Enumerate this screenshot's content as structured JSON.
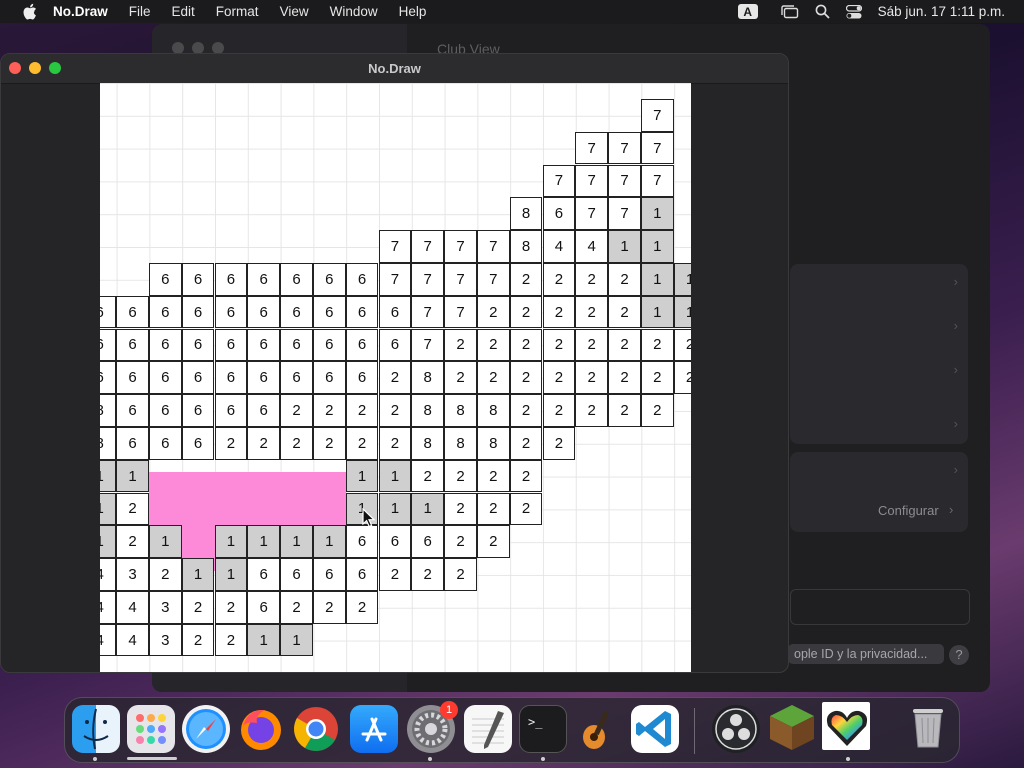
{
  "menubar": {
    "app_name": "No.Draw",
    "menus": [
      "File",
      "Edit",
      "Format",
      "View",
      "Window",
      "Help"
    ],
    "input_source": "A",
    "clock": "Sáb jun. 17  1:11 p.m."
  },
  "background_window": {
    "title": "Club View",
    "configurar_label": "Configurar",
    "privacy_button": "ople ID y la privacidad...",
    "help_label": "?"
  },
  "app_window": {
    "title": "No.Draw",
    "grid": {
      "rows": [
        {
          "r": 0,
          "cells": [
            {
              "c": 17,
              "v": "7"
            }
          ]
        },
        {
          "r": 1,
          "cells": [
            {
              "c": 15,
              "v": "7"
            },
            {
              "c": 16,
              "v": "7"
            },
            {
              "c": 17,
              "v": "7"
            }
          ]
        },
        {
          "r": 2,
          "cells": [
            {
              "c": 14,
              "v": "7"
            },
            {
              "c": 15,
              "v": "7"
            },
            {
              "c": 16,
              "v": "7"
            },
            {
              "c": 17,
              "v": "7"
            }
          ]
        },
        {
          "r": 3,
          "cells": [
            {
              "c": 13,
              "v": "8"
            },
            {
              "c": 14,
              "v": "6"
            },
            {
              "c": 15,
              "v": "7"
            },
            {
              "c": 16,
              "v": "7"
            },
            {
              "c": 17,
              "v": "1",
              "g": true
            }
          ]
        },
        {
          "r": 4,
          "cells": [
            {
              "c": 9,
              "v": "7"
            },
            {
              "c": 10,
              "v": "7"
            },
            {
              "c": 11,
              "v": "7"
            },
            {
              "c": 12,
              "v": "7"
            },
            {
              "c": 13,
              "v": "8"
            },
            {
              "c": 14,
              "v": "4"
            },
            {
              "c": 15,
              "v": "4"
            },
            {
              "c": 16,
              "v": "1",
              "g": true
            },
            {
              "c": 17,
              "v": "1",
              "g": true
            }
          ]
        },
        {
          "r": 5,
          "cells": [
            {
              "c": 2,
              "v": "6"
            },
            {
              "c": 3,
              "v": "6"
            },
            {
              "c": 4,
              "v": "6"
            },
            {
              "c": 5,
              "v": "6"
            },
            {
              "c": 6,
              "v": "6"
            },
            {
              "c": 7,
              "v": "6"
            },
            {
              "c": 8,
              "v": "6"
            },
            {
              "c": 9,
              "v": "7"
            },
            {
              "c": 10,
              "v": "7"
            },
            {
              "c": 11,
              "v": "7"
            },
            {
              "c": 12,
              "v": "7"
            },
            {
              "c": 13,
              "v": "2"
            },
            {
              "c": 14,
              "v": "2"
            },
            {
              "c": 15,
              "v": "2"
            },
            {
              "c": 16,
              "v": "2"
            },
            {
              "c": 17,
              "v": "1",
              "g": true
            },
            {
              "c": 18,
              "v": "1",
              "g": true
            }
          ]
        },
        {
          "r": 6,
          "cells": [
            {
              "c": 0,
              "v": "6"
            },
            {
              "c": 1,
              "v": "6"
            },
            {
              "c": 2,
              "v": "6"
            },
            {
              "c": 3,
              "v": "6"
            },
            {
              "c": 4,
              "v": "6"
            },
            {
              "c": 5,
              "v": "6"
            },
            {
              "c": 6,
              "v": "6"
            },
            {
              "c": 7,
              "v": "6"
            },
            {
              "c": 8,
              "v": "6"
            },
            {
              "c": 9,
              "v": "6"
            },
            {
              "c": 10,
              "v": "7"
            },
            {
              "c": 11,
              "v": "7"
            },
            {
              "c": 12,
              "v": "2"
            },
            {
              "c": 13,
              "v": "2"
            },
            {
              "c": 14,
              "v": "2"
            },
            {
              "c": 15,
              "v": "2"
            },
            {
              "c": 16,
              "v": "2"
            },
            {
              "c": 17,
              "v": "1",
              "g": true
            },
            {
              "c": 18,
              "v": "1",
              "g": true
            }
          ]
        },
        {
          "r": 7,
          "cells": [
            {
              "c": 0,
              "v": "6"
            },
            {
              "c": 1,
              "v": "6"
            },
            {
              "c": 2,
              "v": "6"
            },
            {
              "c": 3,
              "v": "6"
            },
            {
              "c": 4,
              "v": "6"
            },
            {
              "c": 5,
              "v": "6"
            },
            {
              "c": 6,
              "v": "6"
            },
            {
              "c": 7,
              "v": "6"
            },
            {
              "c": 8,
              "v": "6"
            },
            {
              "c": 9,
              "v": "6"
            },
            {
              "c": 10,
              "v": "7"
            },
            {
              "c": 11,
              "v": "2"
            },
            {
              "c": 12,
              "v": "2"
            },
            {
              "c": 13,
              "v": "2"
            },
            {
              "c": 14,
              "v": "2"
            },
            {
              "c": 15,
              "v": "2"
            },
            {
              "c": 16,
              "v": "2"
            },
            {
              "c": 17,
              "v": "2"
            },
            {
              "c": 18,
              "v": "2"
            }
          ]
        },
        {
          "r": 8,
          "cells": [
            {
              "c": 0,
              "v": "6"
            },
            {
              "c": 1,
              "v": "6"
            },
            {
              "c": 2,
              "v": "6"
            },
            {
              "c": 3,
              "v": "6"
            },
            {
              "c": 4,
              "v": "6"
            },
            {
              "c": 5,
              "v": "6"
            },
            {
              "c": 6,
              "v": "6"
            },
            {
              "c": 7,
              "v": "6"
            },
            {
              "c": 8,
              "v": "6"
            },
            {
              "c": 9,
              "v": "2"
            },
            {
              "c": 10,
              "v": "8"
            },
            {
              "c": 11,
              "v": "2"
            },
            {
              "c": 12,
              "v": "2"
            },
            {
              "c": 13,
              "v": "2"
            },
            {
              "c": 14,
              "v": "2"
            },
            {
              "c": 15,
              "v": "2"
            },
            {
              "c": 16,
              "v": "2"
            },
            {
              "c": 17,
              "v": "2"
            },
            {
              "c": 18,
              "v": "2"
            }
          ]
        },
        {
          "r": 9,
          "cells": [
            {
              "c": 0,
              "v": "8"
            },
            {
              "c": 1,
              "v": "6"
            },
            {
              "c": 2,
              "v": "6"
            },
            {
              "c": 3,
              "v": "6"
            },
            {
              "c": 4,
              "v": "6"
            },
            {
              "c": 5,
              "v": "6"
            },
            {
              "c": 6,
              "v": "2"
            },
            {
              "c": 7,
              "v": "2"
            },
            {
              "c": 8,
              "v": "2"
            },
            {
              "c": 9,
              "v": "2"
            },
            {
              "c": 10,
              "v": "8"
            },
            {
              "c": 11,
              "v": "8"
            },
            {
              "c": 12,
              "v": "8"
            },
            {
              "c": 13,
              "v": "2"
            },
            {
              "c": 14,
              "v": "2"
            },
            {
              "c": 15,
              "v": "2"
            },
            {
              "c": 16,
              "v": "2"
            },
            {
              "c": 17,
              "v": "2"
            }
          ]
        },
        {
          "r": 10,
          "cells": [
            {
              "c": 0,
              "v": "8"
            },
            {
              "c": 1,
              "v": "6"
            },
            {
              "c": 2,
              "v": "6"
            },
            {
              "c": 3,
              "v": "6"
            },
            {
              "c": 4,
              "v": "2"
            },
            {
              "c": 5,
              "v": "2"
            },
            {
              "c": 6,
              "v": "2"
            },
            {
              "c": 7,
              "v": "2"
            },
            {
              "c": 8,
              "v": "2"
            },
            {
              "c": 9,
              "v": "2"
            },
            {
              "c": 10,
              "v": "8"
            },
            {
              "c": 11,
              "v": "8"
            },
            {
              "c": 12,
              "v": "8"
            },
            {
              "c": 13,
              "v": "2"
            },
            {
              "c": 14,
              "v": "2"
            }
          ]
        },
        {
          "r": 11,
          "cells": [
            {
              "c": 0,
              "v": "1",
              "g": true
            },
            {
              "c": 1,
              "v": "1",
              "g": true
            },
            {
              "c": 8,
              "v": "1",
              "g": true
            },
            {
              "c": 9,
              "v": "1",
              "g": true
            },
            {
              "c": 10,
              "v": "2"
            },
            {
              "c": 11,
              "v": "2"
            },
            {
              "c": 12,
              "v": "2"
            },
            {
              "c": 13,
              "v": "2"
            }
          ]
        },
        {
          "r": 12,
          "cells": [
            {
              "c": 0,
              "v": "1",
              "g": true
            },
            {
              "c": 1,
              "v": "2"
            },
            {
              "c": 8,
              "v": "1",
              "g": true
            },
            {
              "c": 9,
              "v": "1",
              "g": true
            },
            {
              "c": 10,
              "v": "1",
              "g": true
            },
            {
              "c": 11,
              "v": "2"
            },
            {
              "c": 12,
              "v": "2"
            },
            {
              "c": 13,
              "v": "2"
            }
          ]
        },
        {
          "r": 13,
          "cells": [
            {
              "c": 0,
              "v": "1",
              "g": true
            },
            {
              "c": 1,
              "v": "2"
            },
            {
              "c": 2,
              "v": "1",
              "g": true
            },
            {
              "c": 4,
              "v": "1",
              "g": true
            },
            {
              "c": 5,
              "v": "1",
              "g": true
            },
            {
              "c": 6,
              "v": "1",
              "g": true
            },
            {
              "c": 7,
              "v": "1",
              "g": true
            },
            {
              "c": 8,
              "v": "6"
            },
            {
              "c": 9,
              "v": "6"
            },
            {
              "c": 10,
              "v": "6"
            },
            {
              "c": 11,
              "v": "2"
            },
            {
              "c": 12,
              "v": "2"
            }
          ]
        },
        {
          "r": 14,
          "cells": [
            {
              "c": 0,
              "v": "4"
            },
            {
              "c": 1,
              "v": "3"
            },
            {
              "c": 2,
              "v": "2"
            },
            {
              "c": 3,
              "v": "1",
              "g": true
            },
            {
              "c": 4,
              "v": "1",
              "g": true
            },
            {
              "c": 5,
              "v": "6"
            },
            {
              "c": 6,
              "v": "6"
            },
            {
              "c": 7,
              "v": "6"
            },
            {
              "c": 8,
              "v": "6"
            },
            {
              "c": 9,
              "v": "2"
            },
            {
              "c": 10,
              "v": "2"
            },
            {
              "c": 11,
              "v": "2"
            }
          ]
        },
        {
          "r": 15,
          "cells": [
            {
              "c": 0,
              "v": "4"
            },
            {
              "c": 1,
              "v": "4"
            },
            {
              "c": 2,
              "v": "3"
            },
            {
              "c": 3,
              "v": "2"
            },
            {
              "c": 4,
              "v": "2"
            },
            {
              "c": 5,
              "v": "6"
            },
            {
              "c": 6,
              "v": "2"
            },
            {
              "c": 7,
              "v": "2"
            },
            {
              "c": 8,
              "v": "2"
            }
          ]
        },
        {
          "r": 16,
          "cells": [
            {
              "c": 0,
              "v": "4"
            },
            {
              "c": 1,
              "v": "4"
            },
            {
              "c": 2,
              "v": "3"
            },
            {
              "c": 3,
              "v": "2"
            },
            {
              "c": 4,
              "v": "2"
            },
            {
              "c": 5,
              "v": "1",
              "g": true
            },
            {
              "c": 6,
              "v": "1",
              "g": true
            }
          ]
        }
      ],
      "paint_color": "#fd8ad8",
      "numbered_cell_gray": "#cfcfcf"
    }
  },
  "dock": {
    "apps": [
      "finder-icon",
      "launchpad-icon",
      "safari-icon",
      "firefox-icon",
      "chrome-icon",
      "app-store-icon",
      "system-settings-icon",
      "textedit-icon",
      "terminal-icon",
      "garageband-icon",
      "vscode-icon",
      "obs-icon",
      "minecraft-icon",
      "nodraw-icon",
      "trash-icon"
    ],
    "settings_badge": "1"
  }
}
